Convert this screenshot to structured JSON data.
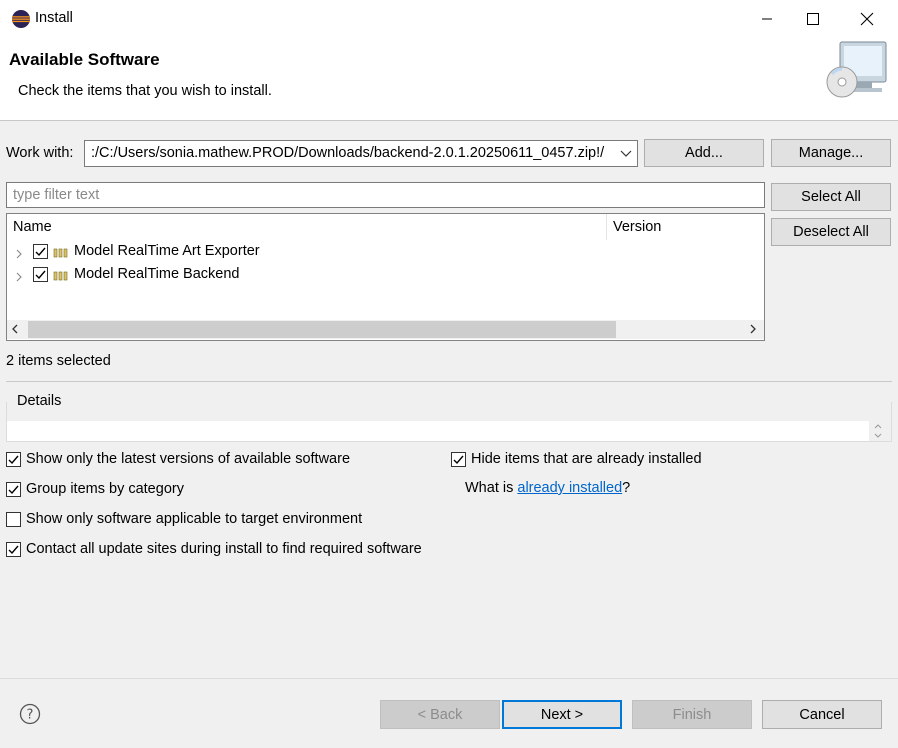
{
  "window": {
    "title": "Install",
    "controls": [
      "minimize-icon",
      "maximize-icon",
      "close-icon"
    ]
  },
  "header": {
    "title": "Available Software",
    "description": "Check the items that you wish to install."
  },
  "work_with": {
    "label": "Work with:",
    "value": ":/C:/Users/sonia.mathew.PROD/Downloads/backend-2.0.1.20250611_0457.zip!/",
    "add_label": "Add...",
    "manage_label": "Manage..."
  },
  "filter": {
    "placeholder": "type filter text"
  },
  "selection_buttons": {
    "select_all": "Select All",
    "deselect_all": "Deselect All"
  },
  "tree": {
    "columns": [
      "Name",
      "Version"
    ],
    "items": [
      {
        "label": "Model RealTime Art Exporter",
        "checked": true,
        "version": ""
      },
      {
        "label": "Model RealTime Backend",
        "checked": true,
        "version": ""
      }
    ]
  },
  "status": {
    "selected_count": "2 items selected"
  },
  "details": {
    "label": "Details"
  },
  "options": {
    "latest_versions": {
      "label": "Show only the latest versions of available software",
      "checked": true
    },
    "group_by_category": {
      "label": "Group items by category",
      "checked": true
    },
    "target_env": {
      "label": "Show only software applicable to target environment",
      "checked": false
    },
    "contact_sites": {
      "label": "Contact all update sites during install to find required software",
      "checked": true
    },
    "hide_installed": {
      "label": "Hide items that are already installed",
      "checked": true
    },
    "what_is_prefix": "What is ",
    "what_is_link": "already installed",
    "what_is_suffix": "?"
  },
  "footer": {
    "back_label": "< Back",
    "next_label": "Next >",
    "finish_label": "Finish",
    "cancel_label": "Cancel"
  },
  "colors": {
    "link": "#0066cc",
    "default_button_border": "#0078d7",
    "background": "#f0f0f0"
  }
}
